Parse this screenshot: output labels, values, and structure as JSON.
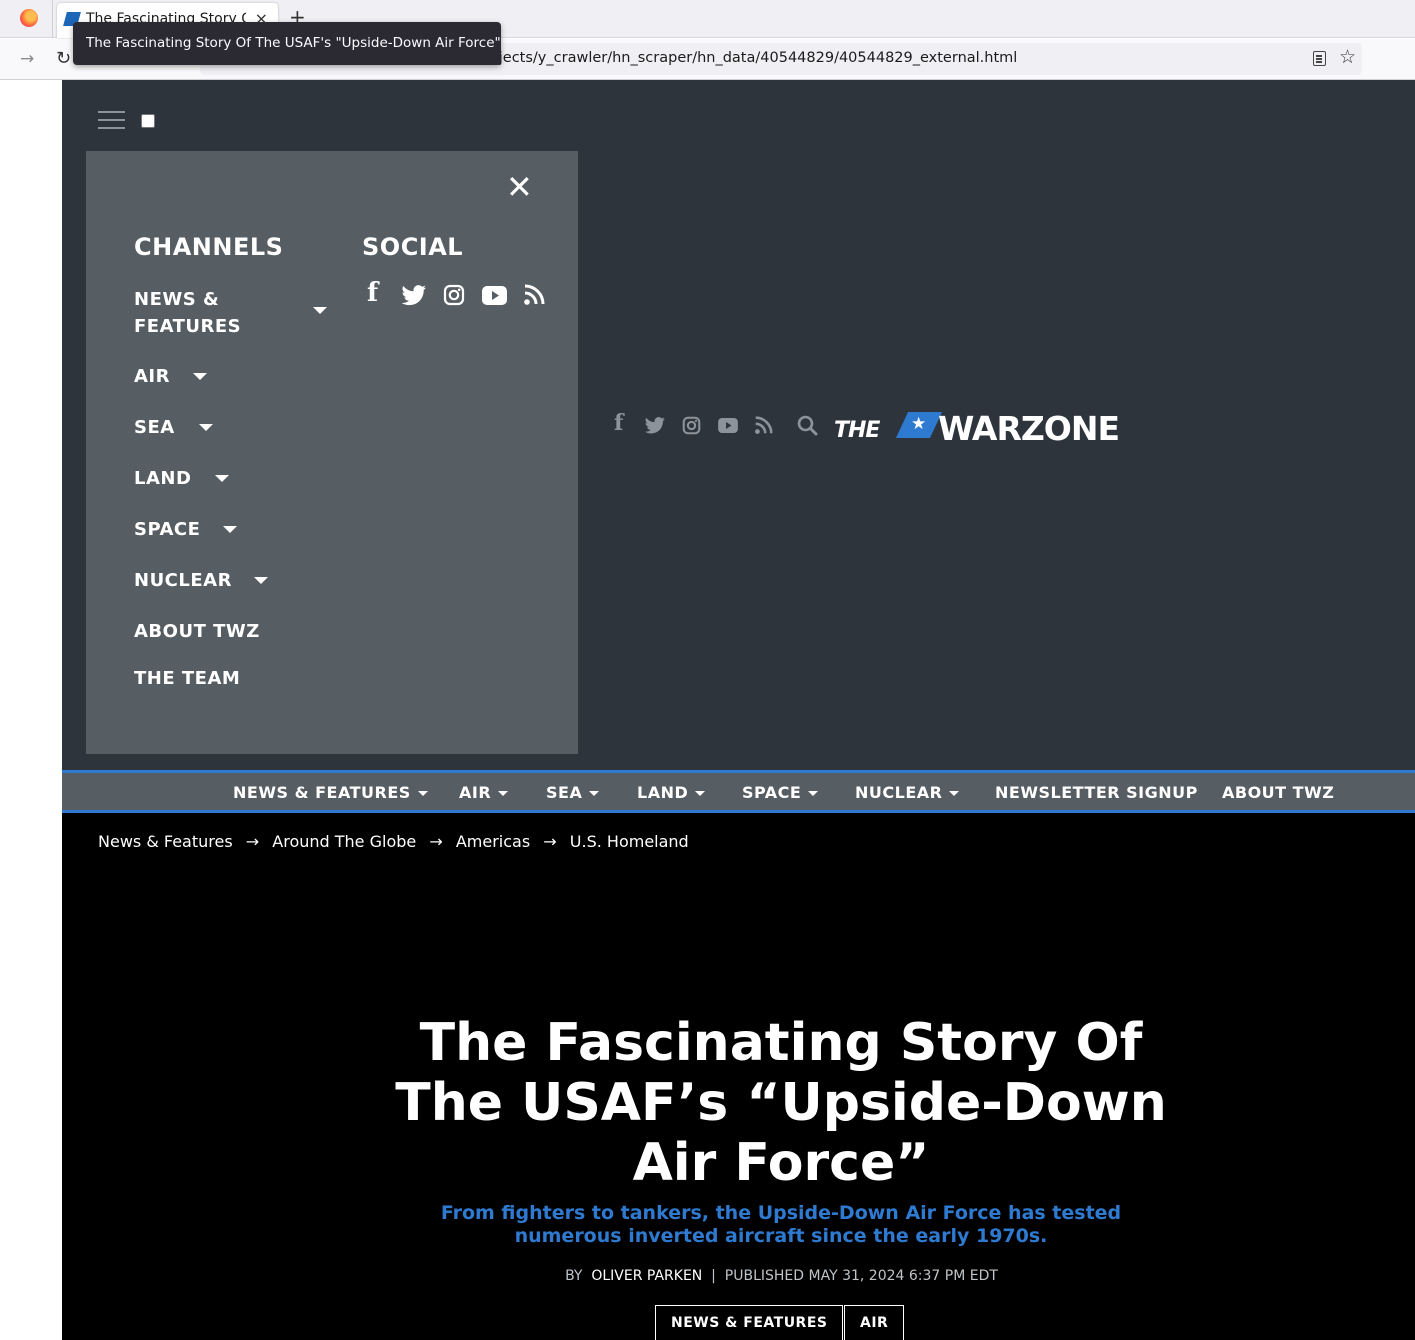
{
  "browser": {
    "tab_title": "The Fascinating Story Of",
    "tab_close": "×",
    "new_tab": "+",
    "url": "file:///home/dvaledinskii/PycharmProjects/y_crawler/hn_scraper/hn_data/40544829/40544829_external.html",
    "tooltip": "The Fascinating Story Of The USAF's \"Upside-Down Air Force\"",
    "forward_icon": "→",
    "reload_icon": "↻",
    "star_icon": "☆"
  },
  "menu": {
    "close_icon": "✕",
    "channels_heading": "CHANNELS",
    "social_heading": "SOCIAL",
    "items": [
      {
        "label": "NEWS & FEATURES"
      },
      {
        "label": "AIR"
      },
      {
        "label": "SEA"
      },
      {
        "label": "LAND"
      },
      {
        "label": "SPACE"
      },
      {
        "label": "NUCLEAR"
      },
      {
        "label": "ABOUT TWZ"
      },
      {
        "label": "THE TEAM"
      }
    ],
    "social_icons": [
      "facebook-icon",
      "twitter-icon",
      "instagram-icon",
      "youtube-icon",
      "rss-icon"
    ]
  },
  "brand": {
    "the": "THE",
    "star": "★",
    "warzone": "WARZONE"
  },
  "mainnav": {
    "items": [
      {
        "label": "NEWS & FEATURES"
      },
      {
        "label": "AIR"
      },
      {
        "label": "SEA"
      },
      {
        "label": "LAND"
      },
      {
        "label": "SPACE"
      },
      {
        "label": "NUCLEAR"
      },
      {
        "label": "NEWSLETTER SIGNUP"
      },
      {
        "label": "ABOUT TWZ"
      }
    ]
  },
  "breadcrumb": {
    "items": [
      "News & Features",
      "Around The Globe",
      "Americas",
      "U.S. Homeland"
    ],
    "separator": "→"
  },
  "article": {
    "headline": "The Fascinating Story Of The USAF’s “Upside-Down Air Force”",
    "dek": "From fighters to tankers, the Upside-Down Air Force has tested numerous inverted aircraft since the early 1970s.",
    "by_label": "BY",
    "author": "OLIVER PARKEN",
    "divider": "|",
    "published": "PUBLISHED MAY 31, 2024 6:37 PM EDT",
    "tags": [
      "NEWS & FEATURES",
      "AIR"
    ]
  },
  "colors": {
    "accent": "#2f7ad1",
    "header_bg": "#2e343b",
    "panel_bg": "#565e63"
  }
}
